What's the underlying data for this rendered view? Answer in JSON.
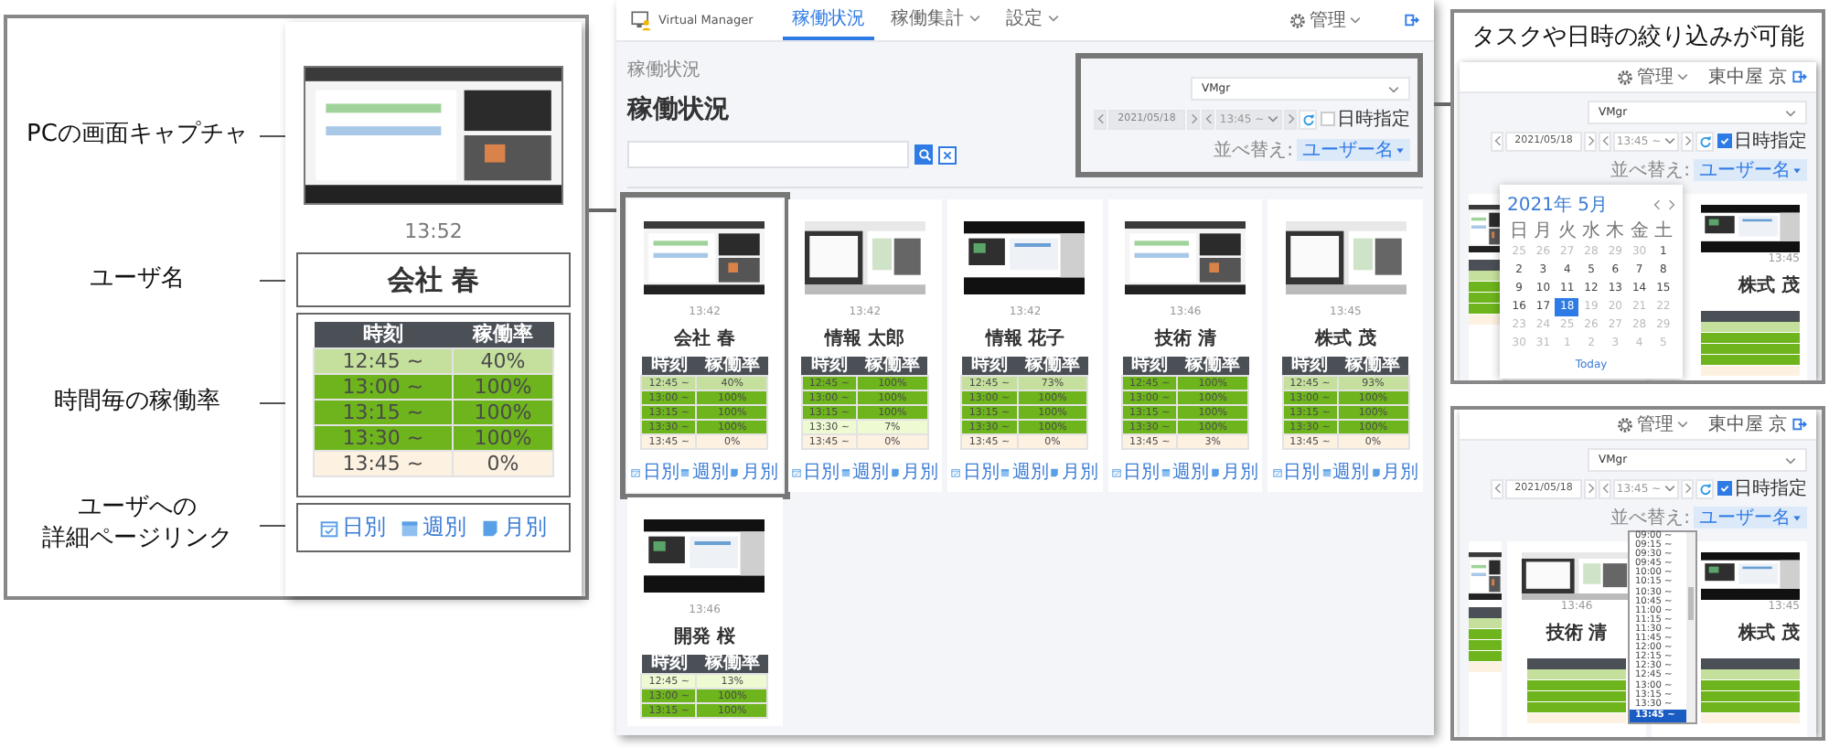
{
  "detail_callout": {
    "labels": [
      {
        "kind": "capture",
        "text": "PCの画面キャプチャ"
      },
      {
        "kind": "name",
        "text": "ユーザ名"
      },
      {
        "kind": "rates",
        "text": "時間毎の稼働率"
      },
      {
        "kind": "links",
        "lines": [
          "ユーザへの",
          "詳細ページリンク"
        ]
      }
    ],
    "card": {
      "time": "13:52",
      "name": "会社 春",
      "table": {
        "columns": [
          "時刻",
          "稼働率"
        ],
        "rows": [
          {
            "time": "12:45 ~",
            "rate": "40%",
            "color": "#c4e09c"
          },
          {
            "time": "13:00 ~",
            "rate": "100%",
            "color": "#6eb41c"
          },
          {
            "time": "13:15 ~",
            "rate": "100%",
            "color": "#6eb41c"
          },
          {
            "time": "13:30 ~",
            "rate": "100%",
            "color": "#6eb41c"
          },
          {
            "time": "13:45 ~",
            "rate": "0%",
            "color": "#fdf2e2"
          }
        ]
      },
      "links": [
        {
          "kind": "daily",
          "label": "日別"
        },
        {
          "kind": "weekly",
          "label": "週別"
        },
        {
          "kind": "monthly",
          "label": "月別"
        }
      ]
    }
  },
  "app": {
    "brand": "Virtual Manager",
    "nav": [
      {
        "label": "稼働状況",
        "selected": true,
        "dropdown": false
      },
      {
        "label": "稼働集計",
        "selected": false,
        "dropdown": true
      },
      {
        "label": "設定",
        "selected": false,
        "dropdown": true
      }
    ],
    "admin_menu": "管理",
    "breadcrumb": "稼働状況",
    "title": "稼働状況",
    "filters": {
      "group": "VMgr",
      "date": "2021/05/18",
      "time": "13:45 ~",
      "disabled": true,
      "date_time_checked": false,
      "date_time_label": "日時指定",
      "sort_label": "並べ替え:",
      "sort_value": "ユーザー名"
    },
    "cards": [
      {
        "highlighted": true,
        "time": "13:42",
        "name": "会社 春",
        "table": {
          "columns": [
            "時刻",
            "稼働率"
          ],
          "rows": [
            {
              "time": "12:45 ~",
              "rate": "40%",
              "color": "#c4e09c"
            },
            {
              "time": "13:00 ~",
              "rate": "100%",
              "color": "#6eb41c"
            },
            {
              "time": "13:15 ~",
              "rate": "100%",
              "color": "#6eb41c"
            },
            {
              "time": "13:30 ~",
              "rate": "100%",
              "color": "#6eb41c"
            },
            {
              "time": "13:45 ~",
              "rate": "0%",
              "color": "#fdf2e2"
            }
          ]
        },
        "links": [
          {
            "kind": "daily",
            "label": "日別"
          },
          {
            "kind": "weekly",
            "label": "週別"
          },
          {
            "kind": "monthly",
            "label": "月別"
          }
        ]
      },
      {
        "highlighted": false,
        "time": "13:42",
        "name": "情報 太郎",
        "table": {
          "columns": [
            "時刻",
            "稼働率"
          ],
          "rows": [
            {
              "time": "12:45 ~",
              "rate": "100%",
              "color": "#6eb41c"
            },
            {
              "time": "13:00 ~",
              "rate": "100%",
              "color": "#6eb41c"
            },
            {
              "time": "13:15 ~",
              "rate": "100%",
              "color": "#6eb41c"
            },
            {
              "time": "13:30 ~",
              "rate": "7%",
              "color": "#eefbd2"
            },
            {
              "time": "13:45 ~",
              "rate": "0%",
              "color": "#fdf2e2"
            }
          ]
        },
        "links": [
          {
            "kind": "daily",
            "label": "日別"
          },
          {
            "kind": "weekly",
            "label": "週別"
          },
          {
            "kind": "monthly",
            "label": "月別"
          }
        ]
      },
      {
        "highlighted": false,
        "time": "13:42",
        "name": "情報 花子",
        "table": {
          "columns": [
            "時刻",
            "稼働率"
          ],
          "rows": [
            {
              "time": "12:45 ~",
              "rate": "73%",
              "color": "#c4e09c"
            },
            {
              "time": "13:00 ~",
              "rate": "100%",
              "color": "#6eb41c"
            },
            {
              "time": "13:15 ~",
              "rate": "100%",
              "color": "#6eb41c"
            },
            {
              "time": "13:30 ~",
              "rate": "100%",
              "color": "#6eb41c"
            },
            {
              "time": "13:45 ~",
              "rate": "0%",
              "color": "#fdf2e2"
            }
          ]
        },
        "links": [
          {
            "kind": "daily",
            "label": "日別"
          },
          {
            "kind": "weekly",
            "label": "週別"
          },
          {
            "kind": "monthly",
            "label": "月別"
          }
        ]
      },
      {
        "highlighted": false,
        "time": "13:46",
        "name": "技術 清",
        "table": {
          "columns": [
            "時刻",
            "稼働率"
          ],
          "rows": [
            {
              "time": "12:45 ~",
              "rate": "100%",
              "color": "#6eb41c"
            },
            {
              "time": "13:00 ~",
              "rate": "100%",
              "color": "#6eb41c"
            },
            {
              "time": "13:15 ~",
              "rate": "100%",
              "color": "#6eb41c"
            },
            {
              "time": "13:30 ~",
              "rate": "100%",
              "color": "#6eb41c"
            },
            {
              "time": "13:45 ~",
              "rate": "3%",
              "color": "#fdf2e2"
            }
          ]
        },
        "links": [
          {
            "kind": "daily",
            "label": "日別"
          },
          {
            "kind": "weekly",
            "label": "週別"
          },
          {
            "kind": "monthly",
            "label": "月別"
          }
        ]
      },
      {
        "highlighted": false,
        "time": "13:45",
        "name": "株式 茂",
        "table": {
          "columns": [
            "時刻",
            "稼働率"
          ],
          "rows": [
            {
              "time": "12:45 ~",
              "rate": "93%",
              "color": "#c4e09c"
            },
            {
              "time": "13:00 ~",
              "rate": "100%",
              "color": "#6eb41c"
            },
            {
              "time": "13:15 ~",
              "rate": "100%",
              "color": "#6eb41c"
            },
            {
              "time": "13:30 ~",
              "rate": "100%",
              "color": "#6eb41c"
            },
            {
              "time": "13:45 ~",
              "rate": "0%",
              "color": "#fdf2e2"
            }
          ]
        },
        "links": [
          {
            "kind": "daily",
            "label": "日別"
          },
          {
            "kind": "weekly",
            "label": "週別"
          },
          {
            "kind": "monthly",
            "label": "月別"
          }
        ]
      },
      {
        "highlighted": false,
        "time": "13:46",
        "name": "開発 桜",
        "table": {
          "columns": [
            "時刻",
            "稼働率"
          ],
          "rows": [
            {
              "time": "12:45 ~",
              "rate": "13%",
              "color": "#eefbd2"
            },
            {
              "time": "13:00 ~",
              "rate": "100%",
              "color": "#6eb41c"
            },
            {
              "time": "13:15 ~",
              "rate": "100%",
              "color": "#6eb41c"
            }
          ]
        }
      }
    ]
  },
  "filter_note": {
    "title": "タスクや日時の絞り込みが可能",
    "insets": [
      {
        "kind": "calendar",
        "admin_menu": "管理",
        "user": "東中屋 京",
        "filters": {
          "group": "VMgr",
          "date": "2021/05/18",
          "time": "13:45 ~",
          "disabled": false,
          "date_time_checked": true,
          "date_time_label": "日時指定",
          "sort_label": "並べ替え:",
          "sort_value": "ユーザー名"
        },
        "cards": [
          {
            "time": "13:45",
            "name": "株式 茂"
          }
        ],
        "calendar": {
          "month": "2021年 5月",
          "weekdays": [
            "日",
            "月",
            "火",
            "水",
            "木",
            "金",
            "土"
          ],
          "weeks": [
            [
              {
                "day": "25",
                "muted": true,
                "selected": false
              },
              {
                "day": "26",
                "muted": true,
                "selected": false
              },
              {
                "day": "27",
                "muted": true,
                "selected": false
              },
              {
                "day": "28",
                "muted": true,
                "selected": false
              },
              {
                "day": "29",
                "muted": true,
                "selected": false
              },
              {
                "day": "30",
                "muted": true,
                "selected": false
              },
              {
                "day": "1",
                "muted": false,
                "selected": false
              }
            ],
            [
              {
                "day": "2",
                "muted": false,
                "selected": false
              },
              {
                "day": "3",
                "muted": false,
                "selected": false
              },
              {
                "day": "4",
                "muted": false,
                "selected": false
              },
              {
                "day": "5",
                "muted": false,
                "selected": false
              },
              {
                "day": "6",
                "muted": false,
                "selected": false
              },
              {
                "day": "7",
                "muted": false,
                "selected": false
              },
              {
                "day": "8",
                "muted": false,
                "selected": false
              }
            ],
            [
              {
                "day": "9",
                "muted": false,
                "selected": false
              },
              {
                "day": "10",
                "muted": false,
                "selected": false
              },
              {
                "day": "11",
                "muted": false,
                "selected": false
              },
              {
                "day": "12",
                "muted": false,
                "selected": false
              },
              {
                "day": "13",
                "muted": false,
                "selected": false
              },
              {
                "day": "14",
                "muted": false,
                "selected": false
              },
              {
                "day": "15",
                "muted": false,
                "selected": false
              }
            ],
            [
              {
                "day": "16",
                "muted": false,
                "selected": false
              },
              {
                "day": "17",
                "muted": false,
                "selected": false
              },
              {
                "day": "18",
                "muted": false,
                "selected": true
              },
              {
                "day": "19",
                "muted": true,
                "selected": false
              },
              {
                "day": "20",
                "muted": true,
                "selected": false
              },
              {
                "day": "21",
                "muted": true,
                "selected": false
              },
              {
                "day": "22",
                "muted": true,
                "selected": false
              }
            ],
            [
              {
                "day": "23",
                "muted": true,
                "selected": false
              },
              {
                "day": "24",
                "muted": true,
                "selected": false
              },
              {
                "day": "25",
                "muted": true,
                "selected": false
              },
              {
                "day": "26",
                "muted": true,
                "selected": false
              },
              {
                "day": "27",
                "muted": true,
                "selected": false
              },
              {
                "day": "28",
                "muted": true,
                "selected": false
              },
              {
                "day": "29",
                "muted": true,
                "selected": false
              }
            ],
            [
              {
                "day": "30",
                "muted": true,
                "selected": false
              },
              {
                "day": "31",
                "muted": true,
                "selected": false
              },
              {
                "day": "1",
                "muted": true,
                "selected": false
              },
              {
                "day": "2",
                "muted": true,
                "selected": false
              },
              {
                "day": "3",
                "muted": true,
                "selected": false
              },
              {
                "day": "4",
                "muted": true,
                "selected": false
              },
              {
                "day": "5",
                "muted": true,
                "selected": false
              }
            ]
          ],
          "today": "Today"
        }
      },
      {
        "kind": "time_list",
        "admin_menu": "管理",
        "user": "東中屋 京",
        "filters": {
          "group": "VMgr",
          "date": "2021/05/18",
          "time": "13:45 ~",
          "disabled": false,
          "date_time_checked": true,
          "date_time_label": "日時指定",
          "sort_label": "並べ替え:",
          "sort_value": "ユーザー名"
        },
        "cards": [
          {
            "time": "13:46",
            "name": "技術 清"
          },
          {
            "time": "13:45",
            "name": "株式 茂"
          }
        ],
        "options": [
          {
            "label": "09:00 ~",
            "selected": false
          },
          {
            "label": "09:15 ~",
            "selected": false
          },
          {
            "label": "09:30 ~",
            "selected": false
          },
          {
            "label": "09:45 ~",
            "selected": false
          },
          {
            "label": "10:00 ~",
            "selected": false
          },
          {
            "label": "10:15 ~",
            "selected": false
          },
          {
            "label": "10:30 ~",
            "selected": false
          },
          {
            "label": "10:45 ~",
            "selected": false
          },
          {
            "label": "11:00 ~",
            "selected": false
          },
          {
            "label": "11:15 ~",
            "selected": false
          },
          {
            "label": "11:30 ~",
            "selected": false
          },
          {
            "label": "11:45 ~",
            "selected": false
          },
          {
            "label": "12:00 ~",
            "selected": false
          },
          {
            "label": "12:15 ~",
            "selected": false
          },
          {
            "label": "12:30 ~",
            "selected": false
          },
          {
            "label": "12:45 ~",
            "selected": false
          },
          {
            "label": "13:00 ~",
            "selected": false
          },
          {
            "label": "13:15 ~",
            "selected": false
          },
          {
            "label": "13:30 ~",
            "selected": false
          },
          {
            "label": "13:45 ~",
            "selected": true
          }
        ]
      }
    ]
  }
}
